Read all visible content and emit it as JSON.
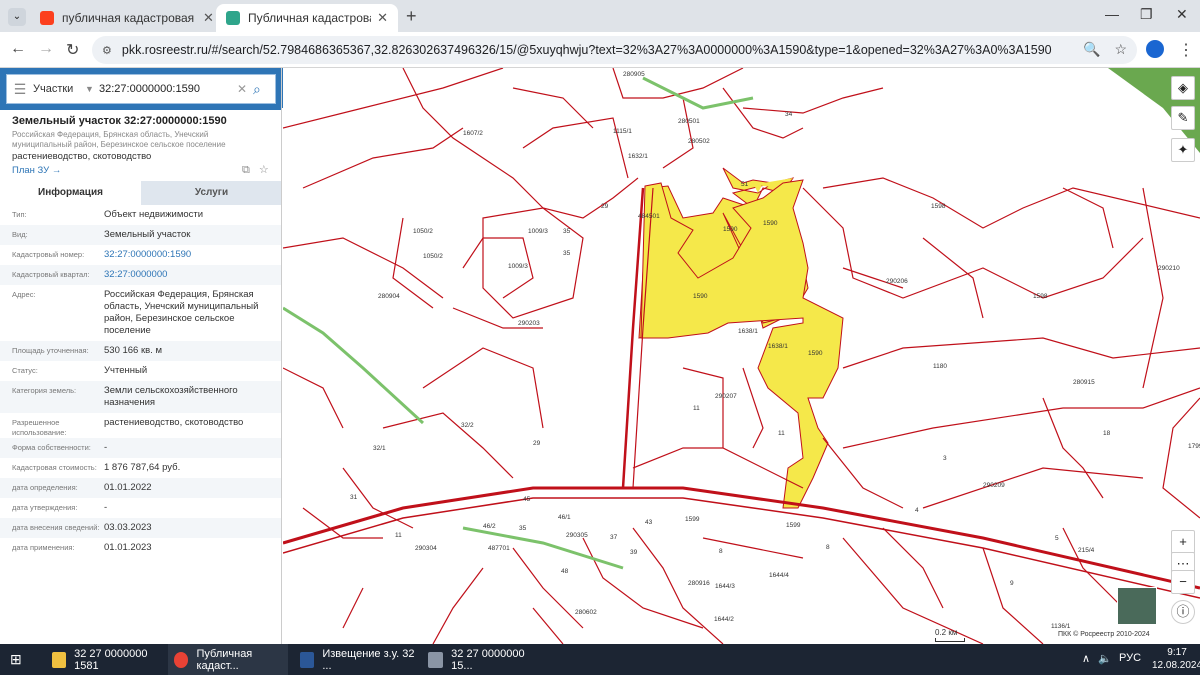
{
  "browser": {
    "tabs": [
      {
        "title": "публичная кадастровая карта",
        "icon": "yandex-icon",
        "active": false
      },
      {
        "title": "Публичная кадастровая карта",
        "icon": "rosreestr-icon",
        "active": true
      }
    ],
    "url": "pkk.rosreestr.ru/#/search/52.7984686365367,32.826302637496326/15/@5xuyqhwju?text=32%3A27%3A0000000%3A1590&type=1&opened=32%3A27%3A0%3A1590"
  },
  "search": {
    "type_label": "Участки",
    "query": "32:27:0000000:1590"
  },
  "object": {
    "heading": "Земельный участок 32:27:0000000:1590",
    "address_short": "Российская Федерация, Брянская область, Унечский муниципальный район, Березинское сельское поселение",
    "usage": "растениеводство, скотоводство",
    "plan_link": "План ЗУ →"
  },
  "info_tabs": {
    "info": "Информация",
    "services": "Услуги"
  },
  "info_rows": [
    {
      "key": "Тип:",
      "value": "Объект недвижимости",
      "link": false
    },
    {
      "key": "Вид:",
      "value": "Земельный участок",
      "link": false
    },
    {
      "key": "Кадастровый номер:",
      "value": "32:27:0000000:1590",
      "link": true
    },
    {
      "key": "Кадастровый квартал:",
      "value": "32:27:0000000",
      "link": true
    },
    {
      "key": "Адрес:",
      "value": "Российская Федерация, Брянская область, Унечский муниципальный район, Березинское сельское поселение",
      "link": false
    },
    {
      "key": "Площадь уточненная:",
      "value": "530 166 кв. м",
      "link": false
    },
    {
      "key": "Статус:",
      "value": "Учтенный",
      "link": false
    },
    {
      "key": "Категория земель:",
      "value": "Земли сельскохозяйственного назначения",
      "link": false
    },
    {
      "key": "Разрешенное использование:",
      "value": "растениеводство, скотоводство",
      "link": false
    },
    {
      "key": "Форма собственности:",
      "value": "-",
      "link": false
    },
    {
      "key": "Кадастровая стоимость:",
      "value": "1 876 787,64 руб.",
      "link": false
    },
    {
      "key": "дата определения:",
      "value": "01.01.2022",
      "link": false
    },
    {
      "key": "дата утверждения:",
      "value": "-",
      "link": false
    },
    {
      "key": "дата внесения сведений:",
      "value": "03.03.2023",
      "link": false
    },
    {
      "key": "дата применения:",
      "value": "01.01.2023",
      "link": false
    }
  ],
  "map": {
    "labels": [
      "280905",
      "280501",
      "280502",
      "1115/1",
      "1632/1",
      "1607/2",
      "29",
      "484501",
      "1009/3",
      "35",
      "1009/3",
      "35",
      "1050/2",
      "1050/2",
      "280904",
      "290203",
      "1590",
      "1590",
      "1590",
      "1590",
      "1598",
      "1598",
      "290206",
      "290210",
      "1638/1",
      "1638/1",
      "1180",
      "280915",
      "290207",
      "11",
      "11",
      "32/2",
      "32/1",
      "29",
      "31",
      "3",
      "290209",
      "18",
      "1799/5",
      "45",
      "46/2",
      "46/1",
      "35",
      "43",
      "1599",
      "1599",
      "290304",
      "290305",
      "487701",
      "11",
      "37",
      "39",
      "8",
      "8",
      "4",
      "5",
      "9",
      "48",
      "280916",
      "1644/3",
      "1644/4",
      "280602",
      "1644/2",
      "1136/1",
      "34",
      "51",
      "215/4"
    ],
    "highlight_color": "#f5e84a",
    "boundary_color": "#c0101a",
    "scale": "0.2 км",
    "copyright": "ПКК © Росреестр 2010-2024"
  },
  "taskbar": {
    "items": [
      {
        "label": "32 27 0000000 1581",
        "icon": "folder-icon"
      },
      {
        "label": "Публичная кадаст...",
        "icon": "chrome-icon"
      },
      {
        "label": "Извещение з.у. 32 ...",
        "icon": "word-icon"
      },
      {
        "label": "32 27 0000000 15...",
        "icon": "scanner-icon"
      }
    ],
    "lang": "РУС",
    "time": "9:17",
    "date": "12.08.2024"
  }
}
